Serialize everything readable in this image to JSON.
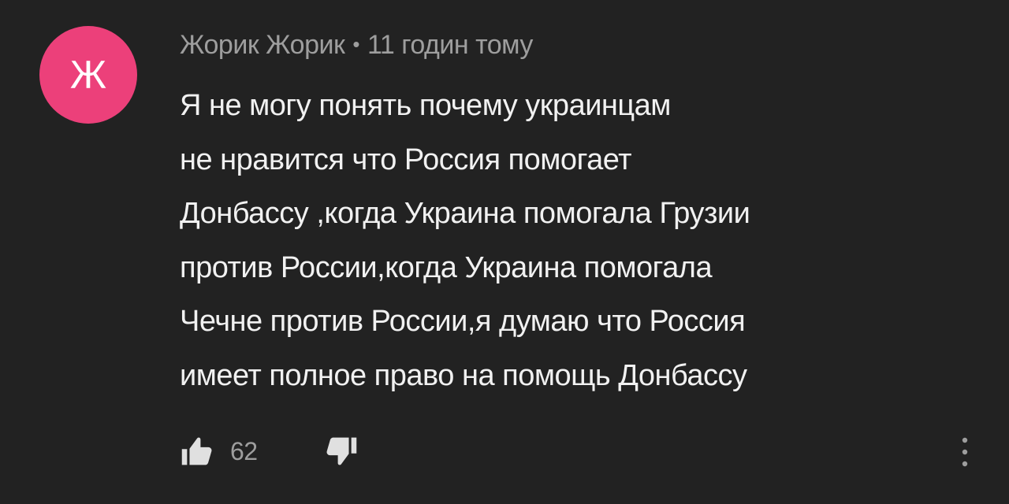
{
  "comment": {
    "avatar_letter": "Ж",
    "avatar_color": "#ec407a",
    "author": "Жорик Жорик",
    "separator": "•",
    "time": "11 годин тому",
    "text_lines": [
      "Я не могу понять почему украинцам",
      "не нравится что Россия помогает",
      "Донбассу ,когда Украина помогала Грузии",
      "против России,когда Украина помогала",
      "Чечне против России,я думаю что Россия",
      "имеет полное право на помощь Донбассу"
    ],
    "like_count": "62",
    "icons": {
      "like": "thumbs-up-icon",
      "dislike": "thumbs-down-icon",
      "menu": "more-vertical-icon"
    }
  }
}
